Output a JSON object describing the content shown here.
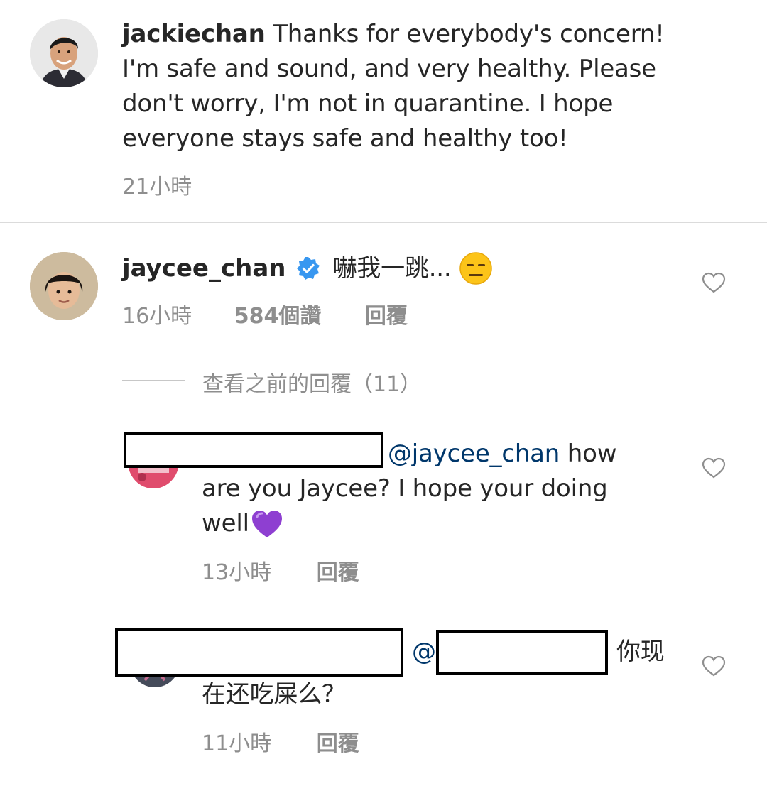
{
  "post_caption": {
    "username": "jackiechan",
    "text": "Thanks for everybody's concern! I'm safe and sound, and very healthy. Please don't worry, I'm not in quarantine. I hope everyone stays safe and healthy too!",
    "time": "21小時"
  },
  "comment_jaycee": {
    "username": "jaycee_chan",
    "verified_icon": "verified-badge-icon",
    "text": "嚇我一跳...",
    "emoji": "😑",
    "time": "16小時",
    "likes": "584個讚",
    "reply_label": "回覆"
  },
  "view_replies": {
    "label": "查看之前的回覆（11）"
  },
  "reply_1": {
    "mention": "@jaycee_chan",
    "text_line1": "how",
    "text_line2": "are you Jaycee? I hope your doing",
    "text_line3": "well",
    "emoji": "💜",
    "time": "13小時",
    "reply_label": "回覆"
  },
  "reply_2": {
    "mention_prefix": "@",
    "text_line1": "你现",
    "text_line2": "在还吃屎么？",
    "time": "11小時",
    "reply_label": "回覆"
  },
  "colors": {
    "text": "#262626",
    "secondary": "#8e8e8e",
    "mention": "#00376b",
    "verified": "#3897f0",
    "divider": "#dbdbdb"
  }
}
